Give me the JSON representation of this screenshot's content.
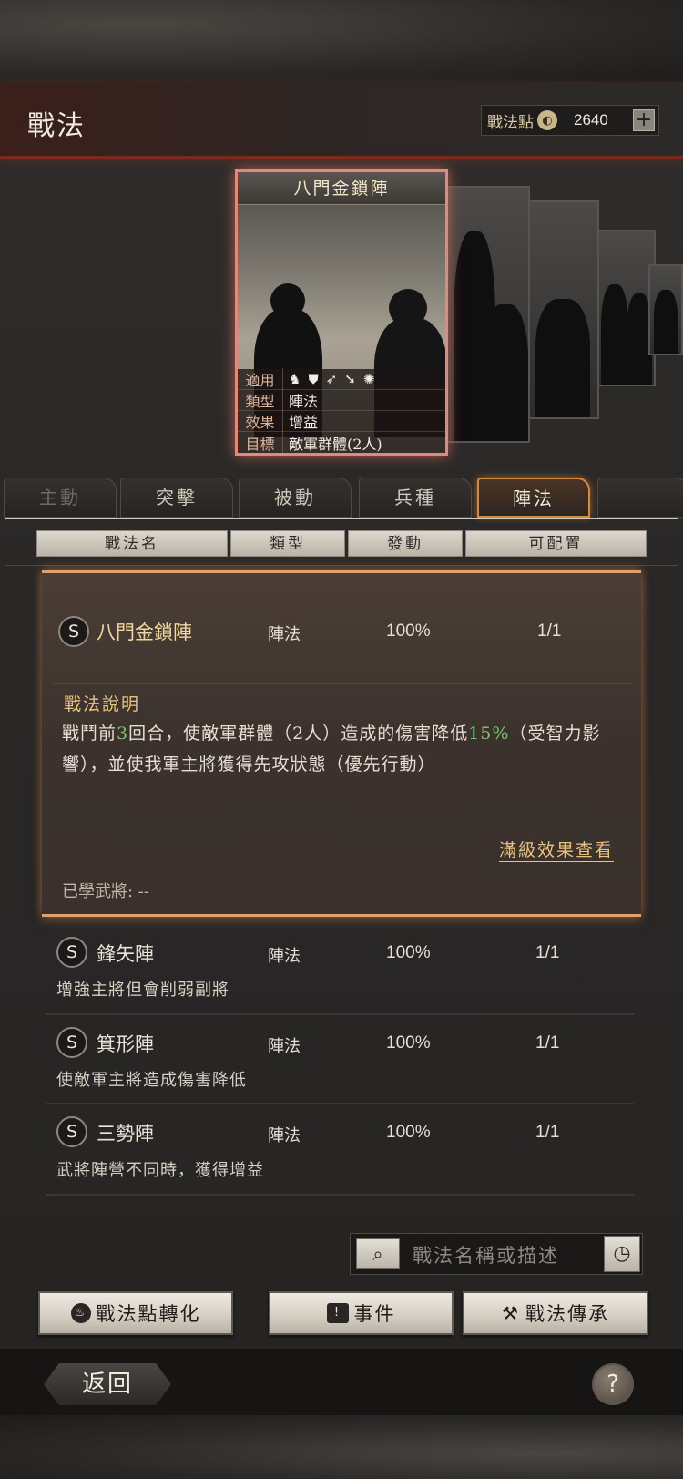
{
  "header": {
    "title": "戰法",
    "points_label": "戰法點",
    "points_icon": "compass-icon",
    "points_value": "2640",
    "plus_label": "+"
  },
  "featured_card": {
    "name": "八門金鎖陣",
    "rows": [
      {
        "key": "適用",
        "icons": [
          "cavalry-icon",
          "shield-icon",
          "bow-icon",
          "spear-icon",
          "wheel-icon"
        ]
      },
      {
        "key": "類型",
        "value": "陣法"
      },
      {
        "key": "效果",
        "value": "增益"
      },
      {
        "key": "目標",
        "value": "敵軍群體(2人)"
      }
    ]
  },
  "tabs": [
    {
      "label": "主動",
      "active": false
    },
    {
      "label": "突擊",
      "active": false
    },
    {
      "label": "被動",
      "active": false
    },
    {
      "label": "兵種",
      "active": false
    },
    {
      "label": "陣法",
      "active": true
    },
    {
      "label": "",
      "active": false
    }
  ],
  "columns": [
    "戰法名",
    "類型",
    "發動",
    "可配置"
  ],
  "expanded_item": {
    "grade": "S",
    "name": "八門金鎖陣",
    "type": "陣法",
    "rate": "100%",
    "slots": "1/1",
    "desc_title": "戰法說明",
    "desc_part1": "戰鬥前",
    "desc_num1": "3",
    "desc_part2": "回合，使敵軍群體（2人）造成的傷害降低",
    "desc_num2": "15%",
    "desc_part3": "（受智力影響），並使我軍主將獲得先攻狀態（優先行動）",
    "full_effect_link": "滿級效果查看",
    "learned_label": "已學武將: --"
  },
  "items": [
    {
      "grade": "S",
      "name": "鋒矢陣",
      "type": "陣法",
      "rate": "100%",
      "slots": "1/1",
      "desc": "增強主將但會削弱副將"
    },
    {
      "grade": "S",
      "name": "箕形陣",
      "type": "陣法",
      "rate": "100%",
      "slots": "1/1",
      "desc": "使敵軍主將造成傷害降低"
    },
    {
      "grade": "S",
      "name": "三勢陣",
      "type": "陣法",
      "rate": "100%",
      "slots": "1/1",
      "desc": "武將陣營不同時，獲得增益"
    }
  ],
  "search": {
    "placeholder": "戰法名稱或描述",
    "search_icon": "magnifier-icon",
    "history_icon": "clock-icon"
  },
  "actions": {
    "convert": "戰法點轉化",
    "event": "事件",
    "inherit": "戰法傳承"
  },
  "footer": {
    "back": "返回",
    "help": "?"
  }
}
